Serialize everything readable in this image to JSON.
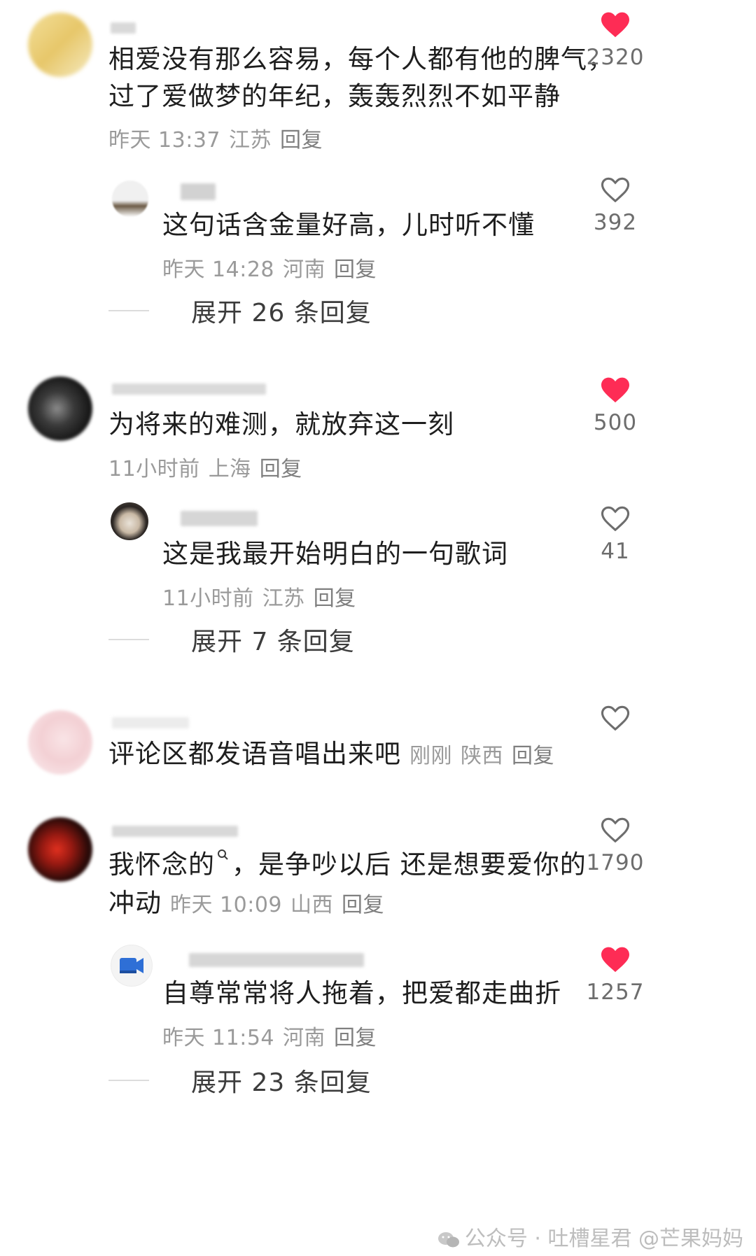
{
  "colors": {
    "liked": "#fe2c55",
    "meta": "#9a9a9a"
  },
  "comments": [
    {
      "text_lines": [
        "相爱没有那么容易，每个人都有他的脾气，",
        "过了爱做梦的年纪，轰轰烈烈不如平静"
      ],
      "time": "昨天 13:37",
      "location": "江苏",
      "reply": "回复",
      "likes": "2320",
      "liked": true,
      "heart_icon": "heart-filled-icon"
    },
    {
      "text": "这句话含金量好高，儿时听不懂",
      "time": "昨天 14:28",
      "location": "河南",
      "reply": "回复",
      "likes": "392",
      "liked": false,
      "heart_icon": "heart-outline-icon"
    },
    {
      "expand": "展开 26 条回复"
    },
    {
      "text": "为将来的难测，就放弃这一刻",
      "time": "11小时前",
      "location": "上海",
      "reply": "回复",
      "likes": "500",
      "liked": true,
      "heart_icon": "heart-filled-icon"
    },
    {
      "text": "这是我最开始明白的一句歌词",
      "time": "11小时前",
      "location": "江苏",
      "reply": "回复",
      "likes": "41",
      "liked": false,
      "heart_icon": "heart-outline-icon"
    },
    {
      "expand": "展开 7 条回复"
    },
    {
      "text": "评论区都发语音唱出来吧",
      "time": "刚刚",
      "location": "陕西",
      "reply": "回复",
      "likes": "",
      "liked": false,
      "heart_icon": "heart-outline-icon"
    },
    {
      "text_lines": [
        "我怀念的",
        "，是争吵以后 还是想要爱你的",
        "冲动"
      ],
      "time": "昨天 10:09",
      "location": "山西",
      "reply": "回复",
      "likes": "1790",
      "liked": false,
      "heart_icon": "heart-outline-icon"
    },
    {
      "text": "自尊常常将人拖着，把爱都走曲折",
      "time": "昨天 11:54",
      "location": "河南",
      "reply": "回复",
      "likes": "1257",
      "liked": true,
      "heart_icon": "heart-filled-icon"
    },
    {
      "expand": "展开 23 条回复"
    }
  ],
  "watermark": "公众号 · 吐槽星君 @芒果妈妈",
  "search_icon": "search-icon"
}
